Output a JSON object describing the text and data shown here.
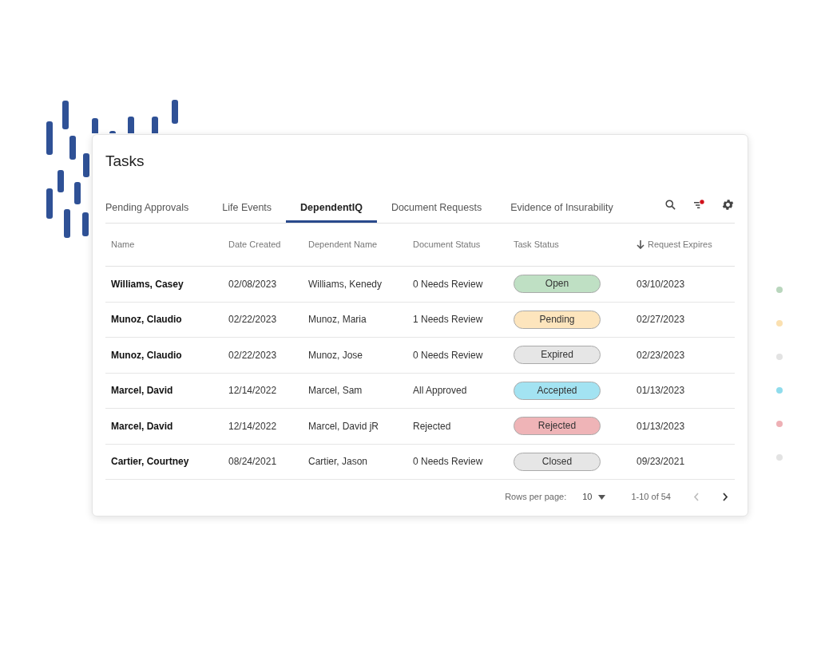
{
  "title": "Tasks",
  "tabs": [
    {
      "label": "Pending Approvals",
      "selected": false
    },
    {
      "label": "Life Events",
      "selected": false
    },
    {
      "label": "DependentIQ",
      "selected": true
    },
    {
      "label": "Document Requests",
      "selected": false
    },
    {
      "label": "Evidence of Insurability",
      "selected": false
    }
  ],
  "filter_active": true,
  "columns": [
    {
      "label": "Name",
      "sorted": false
    },
    {
      "label": "Date Created",
      "sorted": false
    },
    {
      "label": "Dependent Name",
      "sorted": false
    },
    {
      "label": "Document Status",
      "sorted": false
    },
    {
      "label": "Task Status",
      "sorted": false
    },
    {
      "label": "Request Expires",
      "sorted": true
    }
  ],
  "rows": [
    {
      "name": "Williams, Casey",
      "date_created": "02/08/2023",
      "dependent_name": "Williams, Kenedy",
      "document_status": "0 Needs Review",
      "task_status": "Open",
      "color": "#bfe0c4",
      "request_expires": "03/10/2023"
    },
    {
      "name": "Munoz, Claudio",
      "date_created": "02/22/2023",
      "dependent_name": "Munoz, Maria",
      "document_status": "1 Needs Review",
      "task_status": "Pending",
      "color": "#fde5bd",
      "request_expires": "02/27/2023"
    },
    {
      "name": "Munoz, Claudio",
      "date_created": "02/22/2023",
      "dependent_name": "Munoz, Jose",
      "document_status": "0 Needs Review",
      "task_status": "Expired",
      "color": "#e6e6e6",
      "request_expires": "02/23/2023"
    },
    {
      "name": "Marcel, David",
      "date_created": "12/14/2022",
      "dependent_name": "Marcel, Sam",
      "document_status": "All Approved",
      "task_status": "Accepted",
      "color": "#a3e3f2",
      "request_expires": "01/13/2023"
    },
    {
      "name": "Marcel, David",
      "date_created": "12/14/2022",
      "dependent_name": "Marcel, David jR",
      "document_status": "Rejected",
      "task_status": "Rejected",
      "color": "#efb4b7",
      "request_expires": "01/13/2023"
    },
    {
      "name": "Cartier, Courtney",
      "date_created": "08/24/2021",
      "dependent_name": "Cartier, Jason",
      "document_status": "0 Needs Review",
      "task_status": "Closed",
      "color": "#e6e6e6",
      "request_expires": "09/23/2021"
    }
  ],
  "pagination": {
    "rows_per_page_label": "Rows per page:",
    "rows_per_page": "10",
    "range": "1-10 of 54",
    "prev_disabled": true
  },
  "side_dots": [
    {
      "color": "#b9d6bd"
    },
    {
      "color": "#fbe0b0"
    },
    {
      "color": "#e3e3e3"
    },
    {
      "color": "#8fdcec"
    },
    {
      "color": "#eeb0b5"
    },
    {
      "color": "#e3e3e3"
    }
  ]
}
